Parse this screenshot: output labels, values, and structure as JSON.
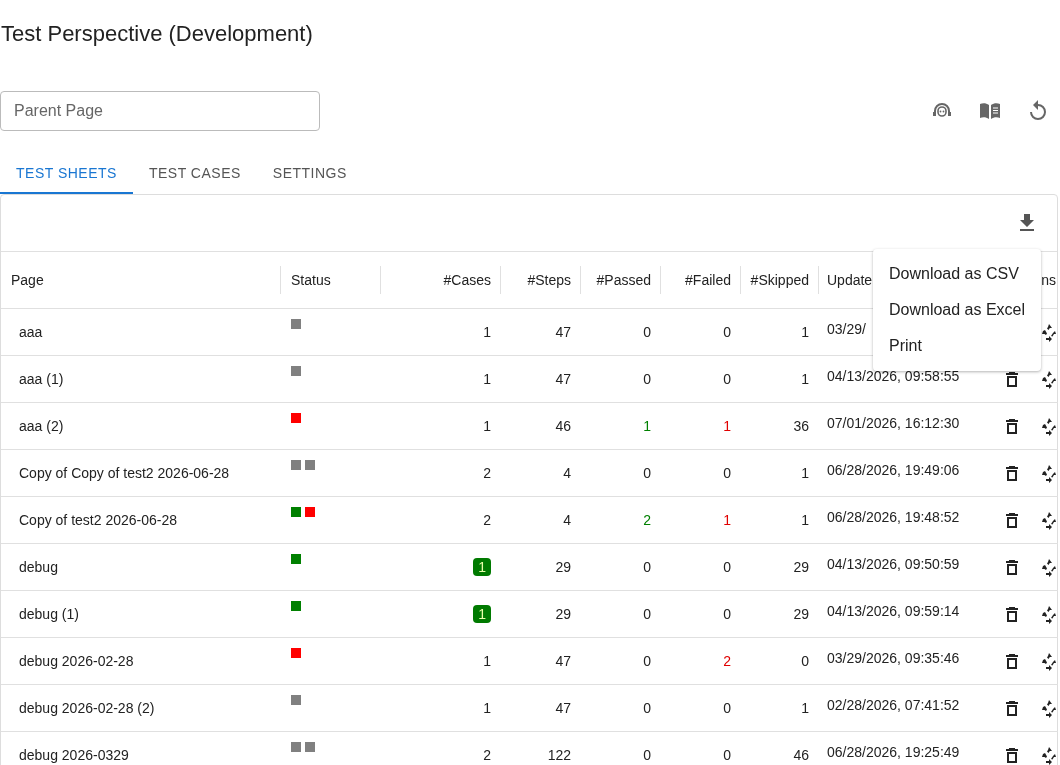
{
  "title": "Test Perspective (Development)",
  "parent_field": {
    "placeholder": "Parent Page"
  },
  "tabs": [
    {
      "label": "TEST SHEETS",
      "selected": true
    },
    {
      "label": "TEST CASES",
      "selected": false
    },
    {
      "label": "SETTINGS",
      "selected": false
    }
  ],
  "table": {
    "columns": [
      "Page",
      "Status",
      "#Cases",
      "#Steps",
      "#Passed",
      "#Failed",
      "#Skipped",
      "Update",
      "ns"
    ],
    "rows": [
      {
        "page": "aaa",
        "status": [
          {
            "color": "#808080"
          }
        ],
        "cases": "1",
        "cases_badge": false,
        "steps": "47",
        "passed": "0",
        "passed_highlight": false,
        "failed": "0",
        "failed_highlight": false,
        "skipped": "1",
        "updated": "03/29/",
        "actions": [
          {
            "kind": "recycle"
          }
        ]
      },
      {
        "page": "aaa (1)",
        "status": [
          {
            "color": "#808080"
          }
        ],
        "cases": "1",
        "cases_badge": false,
        "steps": "47",
        "passed": "0",
        "passed_highlight": false,
        "failed": "0",
        "failed_highlight": false,
        "skipped": "1",
        "updated": "04/13/2026, 09:58:55",
        "actions": [
          {
            "kind": "delete"
          },
          {
            "kind": "recycle"
          }
        ]
      },
      {
        "page": "aaa (2)",
        "status": [
          {
            "color": "#ff0000"
          }
        ],
        "cases": "1",
        "cases_badge": false,
        "steps": "46",
        "passed": "1",
        "passed_highlight": true,
        "failed": "1",
        "failed_highlight": true,
        "skipped": "36",
        "updated": "07/01/2026, 16:12:30",
        "actions": [
          {
            "kind": "delete"
          },
          {
            "kind": "recycle"
          }
        ]
      },
      {
        "page": "Copy of Copy of test2 2026-06-28",
        "status": [
          {
            "color": "#808080"
          },
          {
            "color": "#808080"
          }
        ],
        "cases": "2",
        "cases_badge": false,
        "steps": "4",
        "passed": "0",
        "passed_highlight": false,
        "failed": "0",
        "failed_highlight": false,
        "skipped": "1",
        "updated": "06/28/2026, 19:49:06",
        "actions": [
          {
            "kind": "delete"
          },
          {
            "kind": "recycle"
          }
        ]
      },
      {
        "page": "Copy of test2 2026-06-28",
        "status": [
          {
            "color": "#008000"
          },
          {
            "color": "#ff0000"
          }
        ],
        "cases": "2",
        "cases_badge": false,
        "steps": "4",
        "passed": "2",
        "passed_highlight": true,
        "failed": "1",
        "failed_highlight": true,
        "skipped": "1",
        "updated": "06/28/2026, 19:48:52",
        "actions": [
          {
            "kind": "delete"
          },
          {
            "kind": "recycle"
          }
        ]
      },
      {
        "page": "debug",
        "status": [
          {
            "color": "#008000"
          }
        ],
        "cases": "1",
        "cases_badge": true,
        "steps": "29",
        "passed": "0",
        "passed_highlight": false,
        "failed": "0",
        "failed_highlight": false,
        "skipped": "29",
        "updated": "04/13/2026, 09:50:59",
        "actions": [
          {
            "kind": "delete"
          },
          {
            "kind": "recycle"
          }
        ]
      },
      {
        "page": "debug (1)",
        "status": [
          {
            "color": "#008000"
          }
        ],
        "cases": "1",
        "cases_badge": true,
        "steps": "29",
        "passed": "0",
        "passed_highlight": false,
        "failed": "0",
        "failed_highlight": false,
        "skipped": "29",
        "updated": "04/13/2026, 09:59:14",
        "actions": [
          {
            "kind": "delete"
          },
          {
            "kind": "recycle"
          }
        ]
      },
      {
        "page": "debug 2026-02-28",
        "status": [
          {
            "color": "#ff0000"
          }
        ],
        "cases": "1",
        "cases_badge": false,
        "steps": "47",
        "passed": "0",
        "passed_highlight": false,
        "failed": "2",
        "failed_highlight": true,
        "skipped": "0",
        "updated": "03/29/2026, 09:35:46",
        "actions": [
          {
            "kind": "delete"
          },
          {
            "kind": "recycle"
          }
        ]
      },
      {
        "page": "debug 2026-02-28 (2)",
        "status": [
          {
            "color": "#808080"
          }
        ],
        "cases": "1",
        "cases_badge": false,
        "steps": "47",
        "passed": "0",
        "passed_highlight": false,
        "failed": "0",
        "failed_highlight": false,
        "skipped": "1",
        "updated": "02/28/2026, 07:41:52",
        "actions": [
          {
            "kind": "delete"
          },
          {
            "kind": "recycle"
          }
        ]
      },
      {
        "page": "debug 2026-0329",
        "status": [
          {
            "color": "#808080"
          },
          {
            "color": "#808080"
          }
        ],
        "cases": "2",
        "cases_badge": false,
        "steps": "122",
        "passed": "0",
        "passed_highlight": false,
        "failed": "0",
        "failed_highlight": false,
        "skipped": "46",
        "updated": "06/28/2026, 19:25:49",
        "actions": [
          {
            "kind": "delete"
          },
          {
            "kind": "recycle"
          }
        ]
      }
    ]
  },
  "download_menu": {
    "items": [
      "Download as CSV",
      "Download as Excel",
      "Print"
    ]
  }
}
